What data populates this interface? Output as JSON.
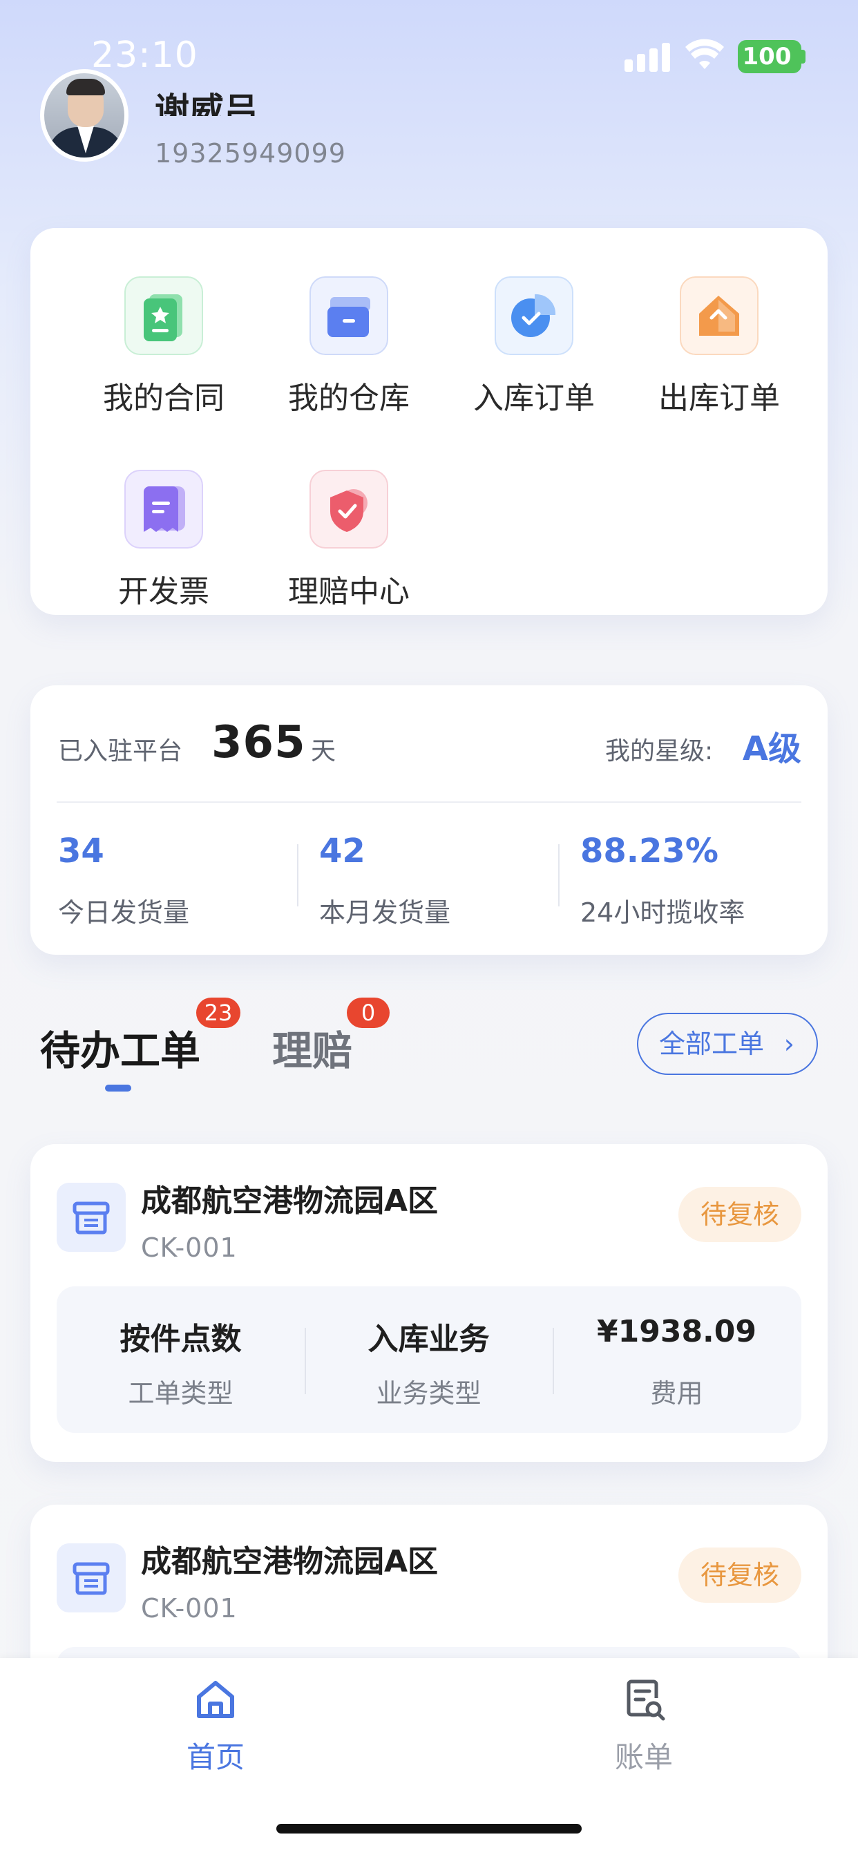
{
  "status_bar": {
    "time": "23:10",
    "battery": "100"
  },
  "profile": {
    "name": "谢威吕",
    "phone": "19325949099"
  },
  "menu": [
    {
      "label": "我的合同",
      "icon": "contract-icon",
      "color": "#48c57a"
    },
    {
      "label": "我的仓库",
      "icon": "warehouse-icon",
      "color": "#5b7ff0"
    },
    {
      "label": "入库订单",
      "icon": "inbound-order-icon",
      "color": "#4a8ff0"
    },
    {
      "label": "出库订单",
      "icon": "outbound-order-icon",
      "color": "#f39a4b"
    },
    {
      "label": "开发票",
      "icon": "invoice-icon",
      "color": "#8c6ff0"
    },
    {
      "label": "理赔中心",
      "icon": "claims-icon",
      "color": "#ec5d6c"
    }
  ],
  "stats": {
    "joined_label": "已入驻平台",
    "joined_days": "365",
    "joined_unit": "天",
    "grade_label": "我的星级:",
    "grade": "A级",
    "metrics": [
      {
        "value": "34",
        "label": "今日发货量"
      },
      {
        "value": "42",
        "label": "本月发货量"
      },
      {
        "value": "88.23%",
        "label": "24小时揽收率"
      }
    ]
  },
  "tabs": [
    {
      "label": "待办工单",
      "badge": "23"
    },
    {
      "label": "理赔",
      "badge": "0"
    }
  ],
  "all_orders_label": "全部工单",
  "orders": [
    {
      "title": "成都航空港物流园A区",
      "code": "CK-001",
      "status": "待复核",
      "details": [
        {
          "value": "按件点数",
          "label": "工单类型"
        },
        {
          "value": "入库业务",
          "label": "业务类型"
        },
        {
          "value": "¥1938.09",
          "label": "费用"
        }
      ]
    },
    {
      "title": "成都航空港物流园A区",
      "code": "CK-001",
      "status": "待复核"
    }
  ],
  "bottom_nav": [
    {
      "label": "首页",
      "icon": "home-icon",
      "active": true
    },
    {
      "label": "账单",
      "icon": "bill-icon",
      "active": false
    }
  ],
  "colors": {
    "accent": "#4a76e0",
    "badge": "#e8462f",
    "status_pending": "#e8973f"
  }
}
